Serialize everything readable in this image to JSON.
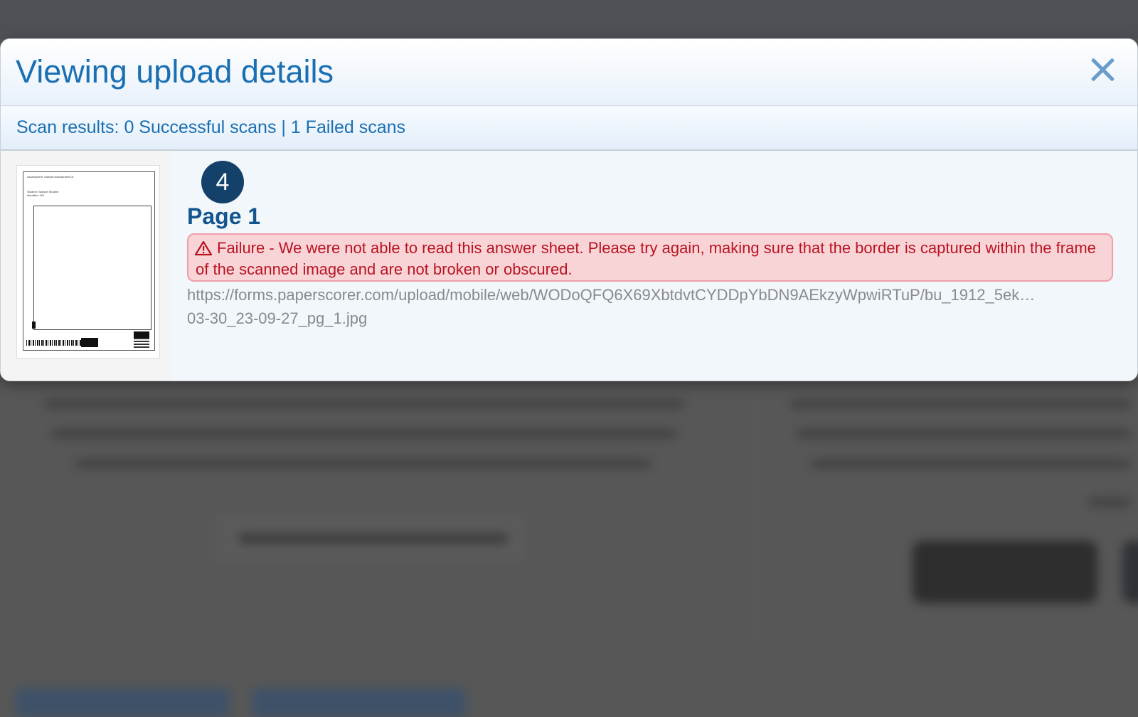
{
  "modal": {
    "title": "Viewing upload details",
    "close_icon": "close-icon",
    "scan_results": "Scan results: 0 Successful scans | 1 Failed scans"
  },
  "upload": {
    "badge_number": "4",
    "page_label": "Page 1",
    "alert_icon": "warning-triangle-icon",
    "failure_message": "Failure - We were not able to read this answer sheet. Please try again, making sure that the border is captured within the frame of the scanned image and are not broken or obscured.",
    "file_url": "https://forms.paperscorer.com/upload/mobile/web/WODoQFQ6X69XbtdvtCYDDpYbDN9AEkzyWpwiRTuP/bu_1912_5ek…",
    "file_name_suffix": "03-30_23-09-27_pg_1.jpg",
    "thumbnail": {
      "assessment_line": "Assessment: Sample Assessment 01",
      "student_line": "Student: Sample Student",
      "identifier_line": "Identifier: 001"
    }
  },
  "colors": {
    "accent": "#1a6fb2",
    "badge": "#13416a",
    "error_text": "#b81422",
    "error_bg": "#f9d4d7"
  }
}
